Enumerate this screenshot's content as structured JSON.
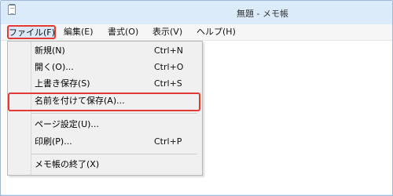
{
  "window": {
    "title": "無題 - メモ帳",
    "icon": "notepad-icon"
  },
  "menubar": {
    "items": [
      {
        "label": "ファイル(F)",
        "active": true
      },
      {
        "label": "編集(E)"
      },
      {
        "label": "書式(O)"
      },
      {
        "label": "表示(V)"
      },
      {
        "label": "ヘルプ(H)"
      }
    ]
  },
  "file_menu": {
    "items": [
      {
        "label": "新規(N)",
        "shortcut": "Ctrl+N"
      },
      {
        "label": "開く(O)...",
        "shortcut": "Ctrl+O"
      },
      {
        "label": "上書き保存(S)",
        "shortcut": "Ctrl+S"
      },
      {
        "label": "名前を付けて保存(A)...",
        "shortcut": "",
        "highlighted": true
      },
      {
        "label": "ページ設定(U)...",
        "shortcut": ""
      },
      {
        "label": "印刷(P)...",
        "shortcut": "Ctrl+P"
      },
      {
        "label": "メモ帳の終了(X)",
        "shortcut": ""
      }
    ]
  },
  "colors": {
    "highlight_border": "#e53935",
    "title_bar": "#dcebf9",
    "menu_background": "#f0f0f0"
  }
}
